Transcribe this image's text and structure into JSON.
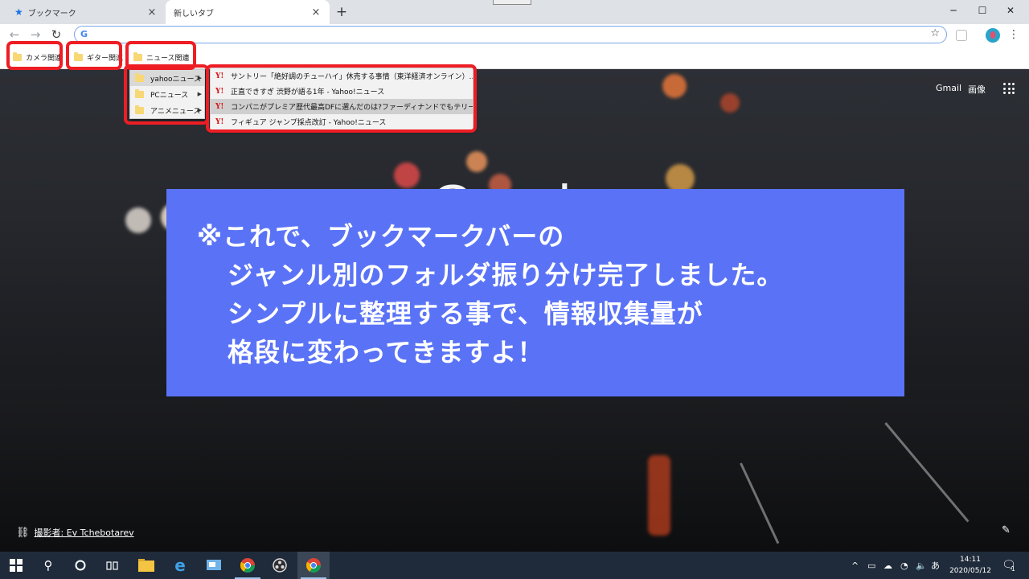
{
  "browser": {
    "tabs": [
      {
        "label": "ブックマーク",
        "active": false
      },
      {
        "label": "新しいタブ",
        "active": true
      }
    ],
    "new_tab_label": "+",
    "window_controls": {
      "minimize": "─",
      "maximize": "☐",
      "close": "✕"
    },
    "nav": {
      "back": "←",
      "forward": "→",
      "reload": "↻"
    },
    "omnibox": {
      "value": "",
      "icon": "google-g-icon"
    },
    "bookmarks_bar": [
      {
        "label": "カメラ関連"
      },
      {
        "label": "ギター関連"
      },
      {
        "label": "ニュース関連"
      }
    ]
  },
  "folder_menu": [
    {
      "label": "yahooニュース",
      "highlighted": true
    },
    {
      "label": "PCニュース",
      "highlighted": false
    },
    {
      "label": "アニメニュース",
      "highlighted": false
    }
  ],
  "submenu": [
    {
      "label": "サントリー「絶好調のチューハイ」休売する事情（東洋経済オンライン）...",
      "highlighted": false
    },
    {
      "label": "正直できすぎ 渋野が語る1年 - Yahoo!ニュース",
      "highlighted": false
    },
    {
      "label": "コンパニがプレミア歴代最高DFに選んだのは?ファーディナンドでもテリーで...",
      "highlighted": true
    },
    {
      "label": "フィギュア ジャンプ採点改訂 - Yahoo!ニュース",
      "highlighted": false
    }
  ],
  "submenu_icon_label": "Y!",
  "ntp": {
    "gmail": "Gmail",
    "images": "画像",
    "logo": "Google",
    "credit": "撮影者: Ev Tchebotarev"
  },
  "note": {
    "lines": [
      "※これで、ブックマークバーの",
      "ジャンル別のフォルダ振り分け完了しました。",
      "シンプルに整理する事で、情報収集量が",
      "格段に変わってきますよ！"
    ],
    "background": "#5a73f6"
  },
  "taskbar": {
    "ime": "あ",
    "time": "14:11",
    "date": "2020/05/12",
    "notification_count": "1"
  },
  "colors": {
    "highlight_red": "#ee1d24",
    "accent_blue": "#1a73e8"
  }
}
